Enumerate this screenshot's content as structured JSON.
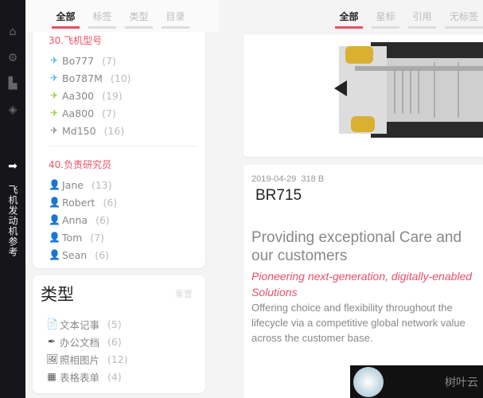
{
  "sidebar": {
    "vertical_label": "飞机发动机参考"
  },
  "left_tabs": [
    "全部",
    "标签",
    "类型",
    "目录"
  ],
  "aircraft": {
    "title": "30.飞机型号",
    "items": [
      {
        "label": "Bo777",
        "count": "(7)",
        "color": "#4ab0ee"
      },
      {
        "label": "Bo787M",
        "count": "(10)",
        "color": "#4ab0ee"
      },
      {
        "label": "Aa300",
        "count": "(19)",
        "color": "#8ccc44"
      },
      {
        "label": "Aa800",
        "count": "(7)",
        "color": "#8ccc44"
      },
      {
        "label": "Md150",
        "count": "(16)",
        "color": "#888888"
      }
    ]
  },
  "researchers": {
    "title": "40.负责研究员",
    "items": [
      {
        "label": "Jane",
        "count": "(13)",
        "color": "#333333"
      },
      {
        "label": "Robert",
        "count": "(6)",
        "color": "#333333"
      },
      {
        "label": "Anna",
        "count": "(6)",
        "color": "#8ccc44"
      },
      {
        "label": "Tom",
        "count": "(7)",
        "color": "#8ccc44"
      },
      {
        "label": "Sean",
        "count": "(6)",
        "color": "#f5a040"
      }
    ]
  },
  "types": {
    "title": "类型",
    "reset": "重置",
    "items": [
      {
        "label": "文本记事",
        "count": "(5)",
        "icon": "📄"
      },
      {
        "label": "办公文档",
        "count": "(6)",
        "icon": "✒"
      },
      {
        "label": "照相图片",
        "count": "(12)",
        "icon": "🖼"
      },
      {
        "label": "表格表单",
        "count": "(4)",
        "icon": "▦"
      }
    ]
  },
  "right_tabs": [
    "全部",
    "星标",
    "引用",
    "无标签"
  ],
  "note": {
    "date": "2019-04-29",
    "size": "318 B",
    "title": "BR715",
    "heading": "Providing exceptional Care and our customers",
    "subheading": "Pioneering next-generation, digitally-enabled Solutions",
    "body": "Offering choice and flexibility throughout the lifecycle via a competitive global network value across the customer base."
  },
  "watermark": "树叶云"
}
